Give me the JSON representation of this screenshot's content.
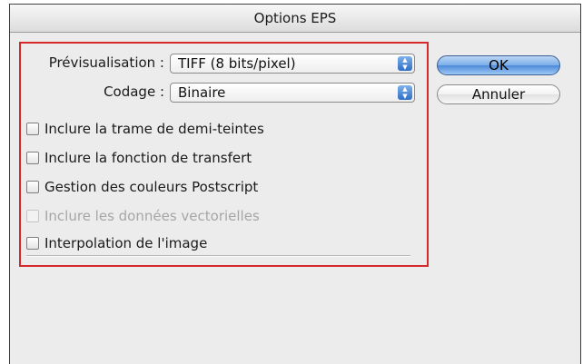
{
  "window": {
    "title": "Options EPS"
  },
  "form": {
    "preview_label": "Prévisualisation :",
    "preview_value": "TIFF (8 bits/pixel)",
    "encoding_label": "Codage :",
    "encoding_value": "Binaire"
  },
  "checkboxes": [
    {
      "label": "Inclure la trame de demi-teintes",
      "checked": false,
      "enabled": true
    },
    {
      "label": "Inclure la fonction de transfert",
      "checked": false,
      "enabled": true
    },
    {
      "label": "Gestion des couleurs Postscript",
      "checked": false,
      "enabled": true
    },
    {
      "label": "Inclure les données vectorielles",
      "checked": false,
      "enabled": false
    },
    {
      "label": "Interpolation de l'image",
      "checked": false,
      "enabled": true
    }
  ],
  "buttons": {
    "ok_label": "OK",
    "cancel_label": "Annuler"
  },
  "colors": {
    "highlight_border": "#d62a2a",
    "default_button": "#7aaee8"
  }
}
